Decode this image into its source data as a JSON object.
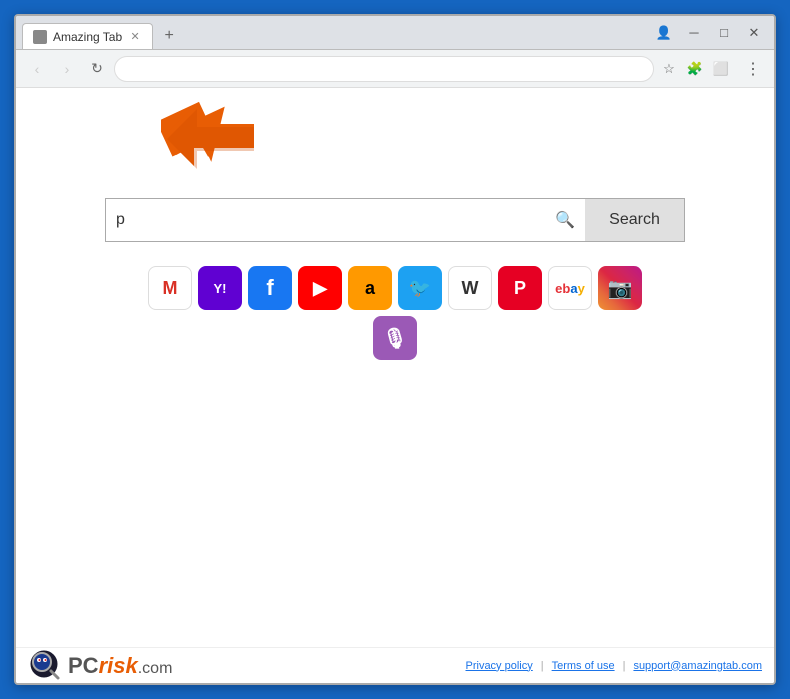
{
  "browser": {
    "tab_title": "Amazing Tab",
    "tab_new_label": "+",
    "url_value": "",
    "url_placeholder": ""
  },
  "window_controls": {
    "profile_icon": "👤",
    "minimize": "─",
    "maximize": "□",
    "close": "✕"
  },
  "nav_buttons": {
    "back": "‹",
    "forward": "›",
    "reload": "↻"
  },
  "address_bar": {
    "search_icon": "🔍",
    "bookmark_icon": "☆",
    "extensions_icon": "🧩",
    "cast_icon": "⬜",
    "menu_icon": "⋮"
  },
  "search": {
    "input_value": "p",
    "search_icon": "🔍",
    "button_label": "Search"
  },
  "quick_links": [
    {
      "id": "gmail",
      "label": "M",
      "title": "Gmail"
    },
    {
      "id": "yahoo",
      "label": "Y!",
      "title": "Yahoo"
    },
    {
      "id": "facebook",
      "label": "f",
      "title": "Facebook"
    },
    {
      "id": "youtube",
      "label": "▶",
      "title": "YouTube"
    },
    {
      "id": "amazon",
      "label": "a",
      "title": "Amazon"
    },
    {
      "id": "twitter",
      "label": "t",
      "title": "Twitter"
    },
    {
      "id": "wikipedia",
      "label": "W",
      "title": "Wikipedia"
    },
    {
      "id": "pinterest",
      "label": "P",
      "title": "Pinterest"
    },
    {
      "id": "ebay",
      "label": "e",
      "title": "eBay"
    },
    {
      "id": "instagram",
      "label": "📷",
      "title": "Instagram"
    },
    {
      "id": "podcast",
      "label": "🎙",
      "title": "Podcast"
    }
  ],
  "footer": {
    "logo_pc": "PC",
    "logo_risk": "risk",
    "logo_dot_com": ".com",
    "links": [
      {
        "label": "Privacy policy",
        "id": "privacy"
      },
      {
        "label": "Terms of use",
        "id": "terms"
      },
      {
        "label": "support@amazingtab.com",
        "id": "support"
      }
    ],
    "separator": "|"
  }
}
